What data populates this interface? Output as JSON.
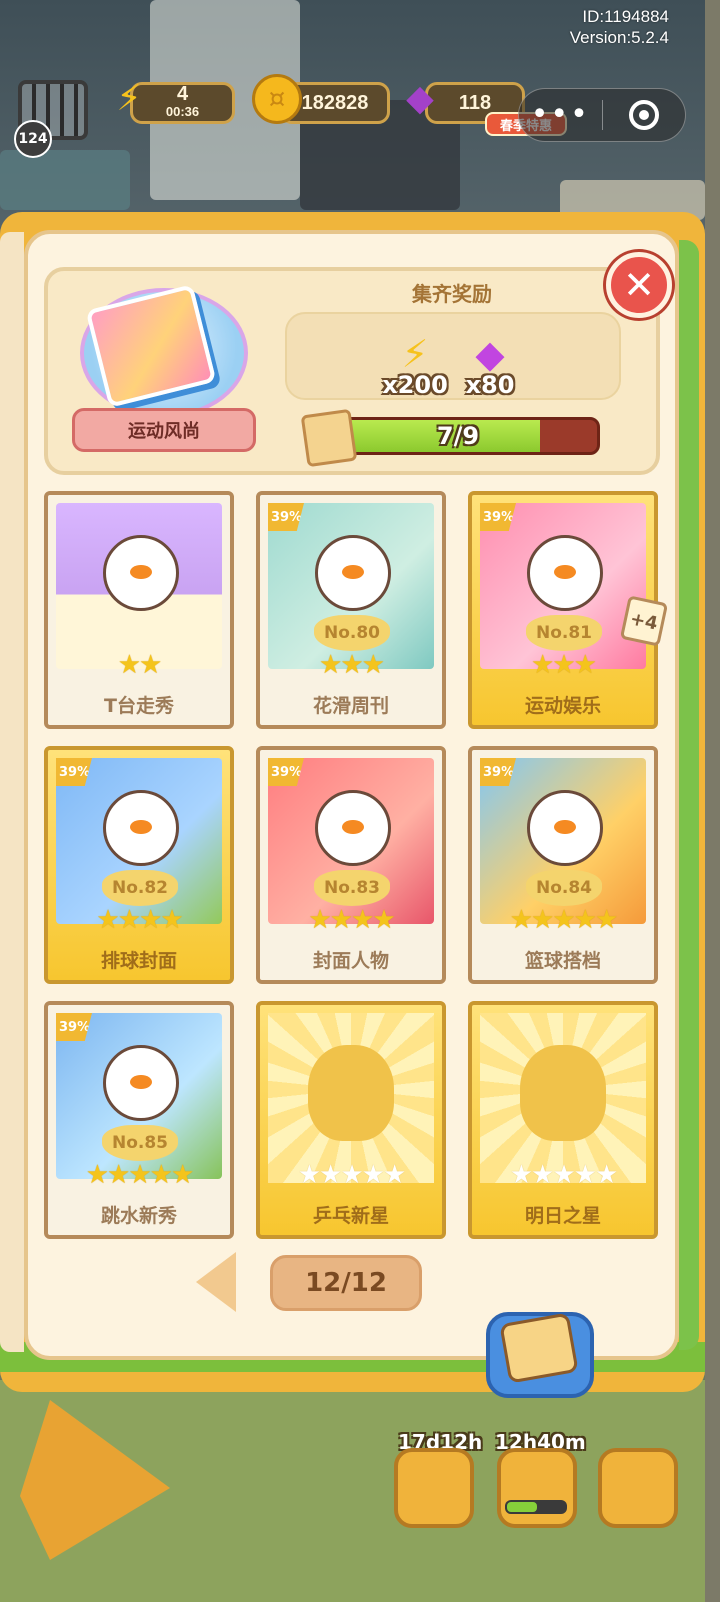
{
  "meta": {
    "id_line": "ID:1194884",
    "version_line": "Version:5.2.4"
  },
  "top_bar": {
    "level": "124",
    "energy_value": "4",
    "energy_timer": "00:36",
    "coins": "182828",
    "gems": "118",
    "event_tag": "春季特惠",
    "more_icon": "more-dots-icon",
    "target_icon": "target-icon"
  },
  "album": {
    "name": "运动风尚",
    "reward_title": "集齐奖励",
    "rewards": [
      {
        "icon": "energy-bolt-icon",
        "amount": "x200"
      },
      {
        "icon": "gem-icon",
        "amount": "x80"
      }
    ],
    "progress_text": "7/9",
    "progress_fraction": 0.7778,
    "close_icon": "close-icon"
  },
  "cards": [
    {
      "name": "T台走秀",
      "number": "",
      "percent": "",
      "stars": 2,
      "max_stars": 2,
      "collected": true,
      "gold": false
    },
    {
      "name": "花滑周刊",
      "number": "No.80",
      "percent": "39%",
      "stars": 3,
      "max_stars": 3,
      "collected": true,
      "gold": false
    },
    {
      "name": "运动娱乐",
      "number": "No.81",
      "percent": "39%",
      "stars": 3,
      "max_stars": 3,
      "collected": true,
      "gold": true,
      "extra": "+4"
    },
    {
      "name": "排球封面",
      "number": "No.82",
      "percent": "39%",
      "stars": 4,
      "max_stars": 4,
      "collected": true,
      "gold": true
    },
    {
      "name": "封面人物",
      "number": "No.83",
      "percent": "39%",
      "stars": 4,
      "max_stars": 4,
      "collected": true,
      "gold": false
    },
    {
      "name": "篮球搭档",
      "number": "No.84",
      "percent": "39%",
      "stars": 5,
      "max_stars": 5,
      "collected": true,
      "gold": false
    },
    {
      "name": "跳水新秀",
      "number": "No.85",
      "percent": "39%",
      "stars": 5,
      "max_stars": 5,
      "collected": true,
      "gold": false
    },
    {
      "name": "乒乓新星",
      "number": "",
      "percent": "",
      "stars": 0,
      "max_stars": 5,
      "collected": false,
      "gold": true
    },
    {
      "name": "明日之星",
      "number": "",
      "percent": "",
      "stars": 0,
      "max_stars": 5,
      "collected": false,
      "gold": true
    }
  ],
  "pagination": {
    "page_label": "12/12",
    "prev_icon": "arrow-left-icon"
  },
  "bottom": {
    "timer_1": "17d12h",
    "timer_2": "12h40m",
    "progress_fraction": 0.45
  },
  "colors": {
    "book_gold": "#f0b53b",
    "page_cream": "#fdf3df",
    "progress_green": "#8cc92e",
    "progress_track": "#9b3a2a",
    "close_red": "#e9544c",
    "star_gold": "#f4c41c"
  }
}
